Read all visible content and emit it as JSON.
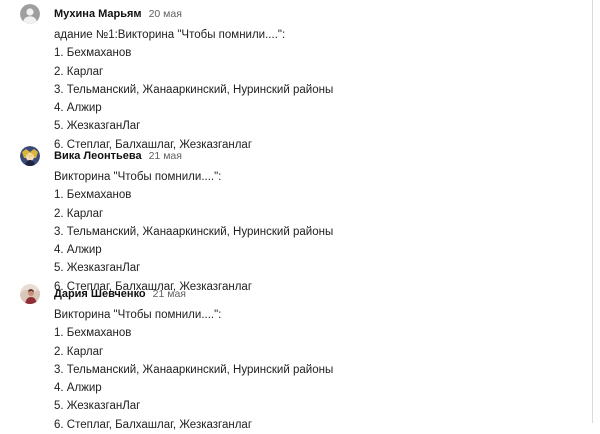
{
  "comments": [
    {
      "author": "Мухина Марьям",
      "date": "20 мая",
      "avatar": "default-avatar-icon",
      "lines": [
        "адание №1:Викторина \"Чтобы помнили....\":",
        "1. Бехмаханов",
        "2. Карлаг",
        "3. Тельманский, Жанааркинский, Нуринский районы",
        "4. Алжир",
        "5. ЖезказганЛаг",
        "6. Степлаг, Балхашлаг, Жезказганлаг"
      ]
    },
    {
      "author": "Вика Леонтьева",
      "date": "21 мая",
      "avatar": "anime-character-avatar-icon",
      "lines": [
        "Викторина \"Чтобы помнили....\":",
        "1. Бехмаханов",
        "2. Карлаг",
        "3. Тельманский, Жанааркинский, Нуринский районы",
        "4. Алжир",
        "5. ЖезказганЛаг",
        "6. Степлаг, Балхашлаг, Жезказганлаг"
      ]
    },
    {
      "author": "Дария Шевченко",
      "date": "21 мая",
      "avatar": "photo-avatar-icon",
      "lines": [
        "Викторина \"Чтобы помнили....\":",
        "1. Бехмаханов",
        "2. Карлаг",
        "3. Тельманский, Жанааркинский, Нуринский районы",
        "4. Алжир",
        "5. ЖезказганЛаг",
        "6. Степлаг, Балхашлаг, Жезказганлаг"
      ]
    }
  ]
}
